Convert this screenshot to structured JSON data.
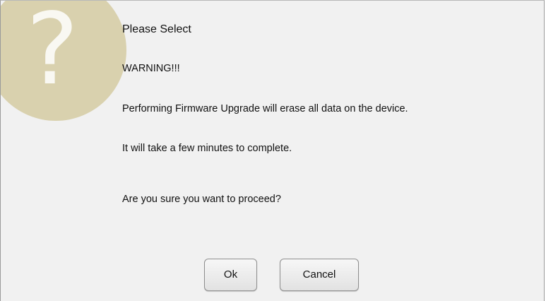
{
  "dialog": {
    "icon": "question-icon",
    "title": "Please Select",
    "lines": [
      "WARNING!!!",
      "Performing Firmware Upgrade will erase all data on the device.",
      "It will take a few minutes to complete.",
      "Are you sure you want to proceed?"
    ],
    "ok_label": "Ok",
    "cancel_label": "Cancel"
  },
  "colors": {
    "dialog_background": "#f1f1f1",
    "icon_circle": "#d9d1ae",
    "icon_glyph": "#ffffff"
  }
}
